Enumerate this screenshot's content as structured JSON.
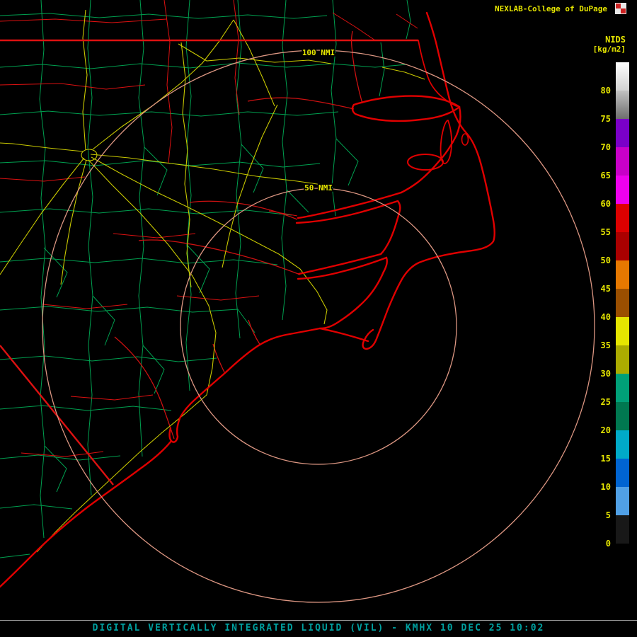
{
  "header": {
    "title": "NEXLAB-College of DuPage"
  },
  "product": {
    "id_label": "NIDS",
    "units_label": "[kg/m2]"
  },
  "colorbar": {
    "unit": "kg/m2",
    "labels": [
      "80",
      "75",
      "70",
      "65",
      "60",
      "55",
      "50",
      "45",
      "40",
      "35",
      "30",
      "25",
      "20",
      "15",
      "10",
      "5",
      "0"
    ],
    "segments": [
      {
        "range": "above 80",
        "c1": "#FFFFFF",
        "c2": "#D2D2D2"
      },
      {
        "range": "75-80",
        "c1": "#C2C2C2",
        "c2": "#6E6E6E"
      },
      {
        "range": "70-75",
        "c1": "#7A00C8",
        "c2": "#7A00C8"
      },
      {
        "range": "65-70",
        "c1": "#C800C8",
        "c2": "#C800C8"
      },
      {
        "range": "60-65",
        "c1": "#EE00EE",
        "c2": "#EE00EE"
      },
      {
        "range": "55-60",
        "c1": "#DC0000",
        "c2": "#DC0000"
      },
      {
        "range": "50-55",
        "c1": "#AA0000",
        "c2": "#AA0000"
      },
      {
        "range": "45-50",
        "c1": "#E67800",
        "c2": "#E67800"
      },
      {
        "range": "40-45",
        "c1": "#9B4F00",
        "c2": "#9B4F00"
      },
      {
        "range": "35-40",
        "c1": "#E6E600",
        "c2": "#E6E600"
      },
      {
        "range": "30-35",
        "c1": "#ABAB00",
        "c2": "#ABAB00"
      },
      {
        "range": "25-30",
        "c1": "#00A078",
        "c2": "#00A078"
      },
      {
        "range": "20-25",
        "c1": "#007850",
        "c2": "#007850"
      },
      {
        "range": "15-20",
        "c1": "#00AAC8",
        "c2": "#00AAC8"
      },
      {
        "range": "10-15",
        "c1": "#0064D2",
        "c2": "#0064D2"
      },
      {
        "range": "5-10",
        "c1": "#50A0E6",
        "c2": "#50A0E6"
      },
      {
        "range": "0-5",
        "c1": "#181818",
        "c2": "#181818"
      }
    ]
  },
  "rings": {
    "outer_label": "100 NMI",
    "inner_label": "50 NMI"
  },
  "map": {
    "colors": {
      "background": "#000000",
      "coastline": "#E00000",
      "county_lines": "#00A050",
      "state_borders": "#DD1111",
      "rivers": "#CC1111",
      "roads": "#C8C800",
      "range_rings": "#DC9682",
      "labels": "#E6E600",
      "footer_text": "#00A0A0"
    }
  },
  "footer": {
    "caption": "DIGITAL VERTICALLY INTEGRATED LIQUID (VIL) - KMHX 10 DEC 25 10:02",
    "product_name": "DIGITAL VERTICALLY INTEGRATED LIQUID (VIL)",
    "station": "KMHX",
    "datetime": "10 DEC 25 10:02"
  }
}
